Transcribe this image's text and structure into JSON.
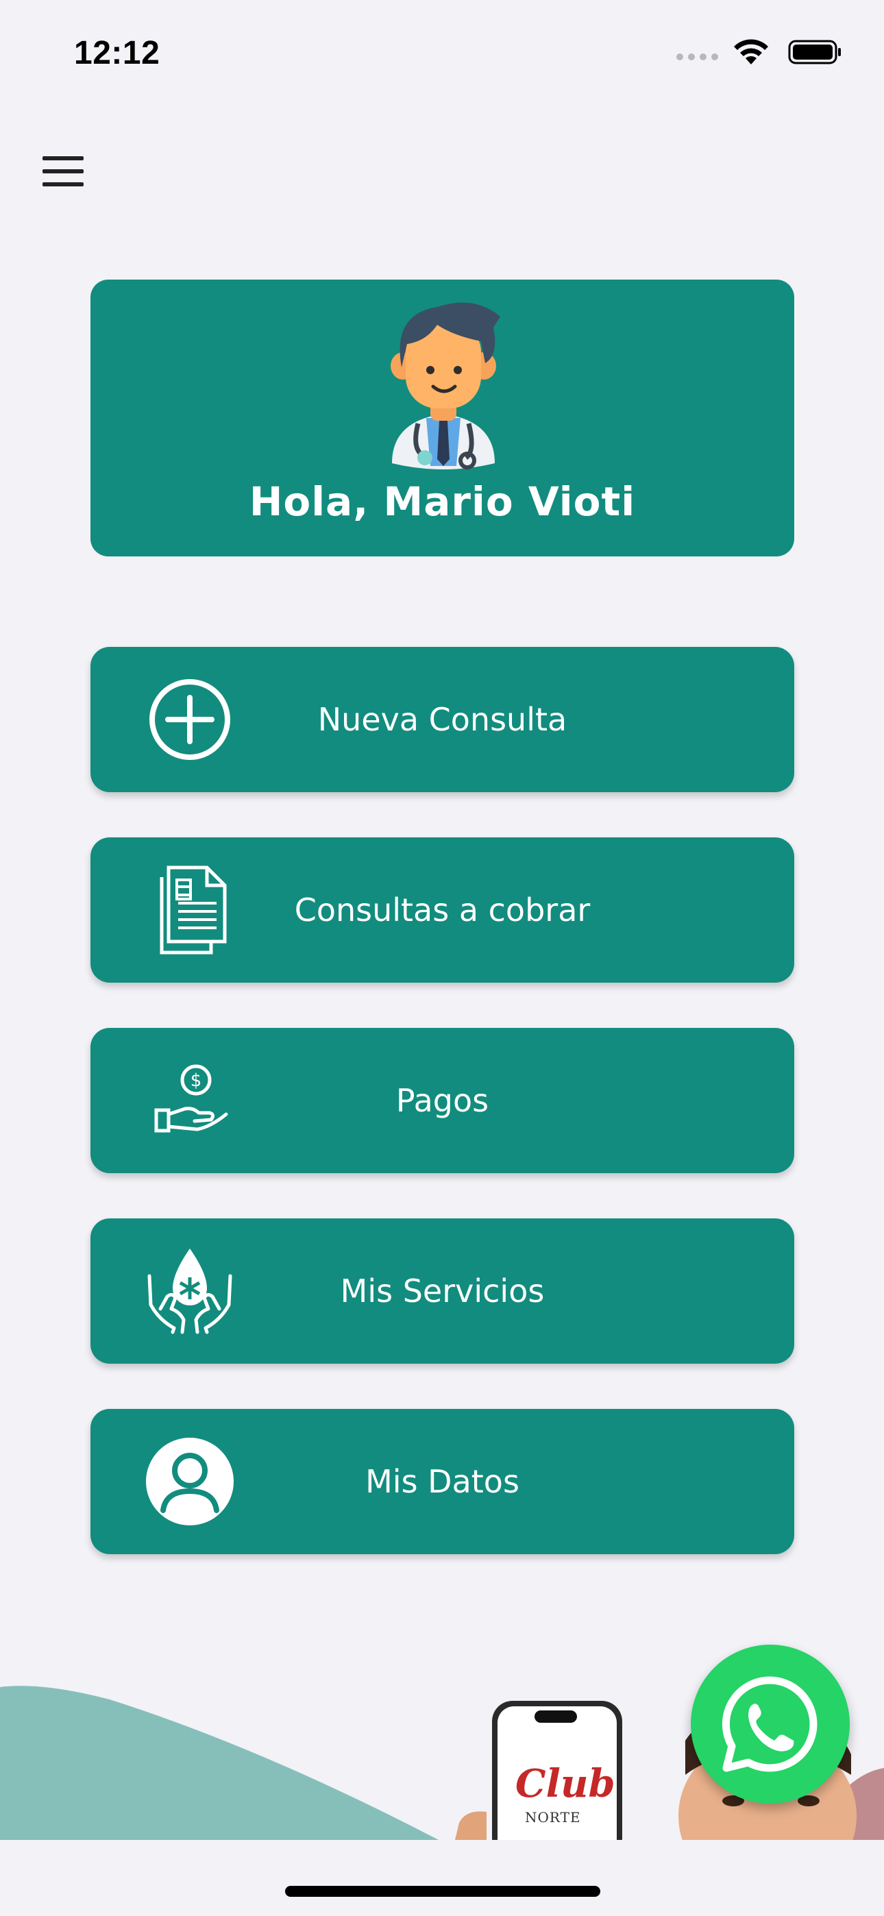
{
  "status_bar": {
    "time": "12:12"
  },
  "header": {
    "menu_icon": "hamburger-menu-icon"
  },
  "hero": {
    "greeting": "Hola, Mario Vioti",
    "avatar": "doctor-avatar"
  },
  "menu": {
    "items": [
      {
        "label": "Nueva Consulta",
        "icon": "plus-circle-icon"
      },
      {
        "label": "Consultas a cobrar",
        "icon": "document-list-icon"
      },
      {
        "label": "Pagos",
        "icon": "hand-coin-icon"
      },
      {
        "label": "Mis Servicios",
        "icon": "hands-drop-icon"
      },
      {
        "label": "Mis Datos",
        "icon": "user-circle-icon"
      }
    ]
  },
  "footer_banner": {
    "phone_logo_line1": "Club",
    "phone_logo_line2": "NORTE"
  },
  "colors": {
    "primary": "#128c7e",
    "background": "#f2f2f7",
    "whatsapp": "#25d366"
  },
  "fab": {
    "icon": "whatsapp-icon"
  }
}
